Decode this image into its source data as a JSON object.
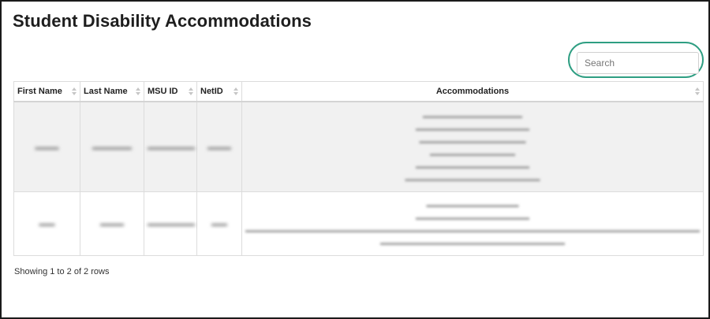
{
  "page": {
    "title": "Student Disability Accommodations"
  },
  "search": {
    "placeholder": "Search",
    "value": "",
    "highlight_color": "#2e9e82"
  },
  "table": {
    "columns": [
      "First Name",
      "Last Name",
      "MSU ID",
      "NetID",
      "Accommodations"
    ]
  },
  "footer": {
    "text": "Showing 1 to 2 of 2 rows"
  },
  "colors": {
    "row_stripe": "#f1f1f1",
    "border": "#dcdcdc",
    "frame": "#1a1a1a"
  }
}
